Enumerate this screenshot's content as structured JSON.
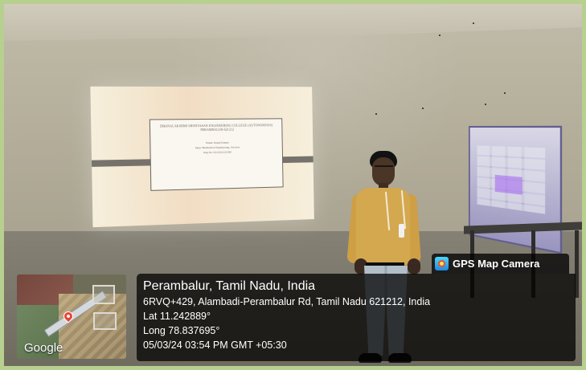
{
  "photo": {
    "scene": "Seminar hall photo with projected slide, presenter, and poster stand"
  },
  "projected_slide": {
    "title": "DHANALAKSHMI SRINIVASAN ENGINEERING COLLEGE (AUTONOMOUS) PERAMBALUR-621212",
    "presenter": "Name: Ragul Kumar",
    "department": "Dept: Biomedical Engineering, 3rd year",
    "register_number": "Reg No: 8115221121030"
  },
  "gps_overlay": {
    "app_name": "GPS Map Camera",
    "location": "Perambalur, Tamil Nadu, India",
    "address": "6RVQ+429, Alambadi-Perambalur Rd, Tamil Nadu 621212, India",
    "latitude": "Lat 11.242889°",
    "longitude": "Long 78.837695°",
    "timestamp": "05/03/24 03:54 PM GMT +05:30"
  },
  "map_thumbnail": {
    "attribution": "Google"
  },
  "icons": {
    "camera": "gps-map-camera-icon",
    "pin": "map-pin-icon"
  },
  "colors": {
    "overlay": "#000000",
    "pin": "#ea4335",
    "accent": "#1f88e5"
  }
}
